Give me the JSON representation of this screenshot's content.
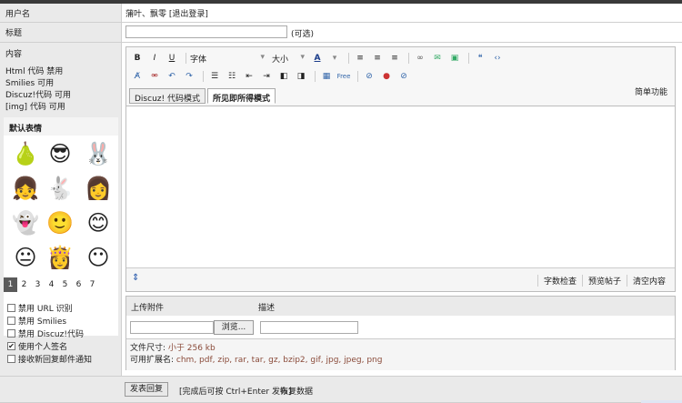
{
  "username": {
    "label": "用户名",
    "value": "蒲叶、飘零 [退出登录]"
  },
  "subject": {
    "label": "标题",
    "value": "",
    "optional": "(可选)"
  },
  "content": {
    "label": "内容",
    "status": [
      "Html 代码 禁用",
      "Smilies 可用",
      "Discuz!代码 可用",
      "[img] 代码 可用"
    ],
    "smilies_title": "默认表情",
    "smilies": [
      "pear-face-icon",
      "cool-sunglasses-face-icon",
      "pink-bunny-icon",
      "gray-hair-girl-icon",
      "bunny-girl-icon",
      "red-hair-girl-icon",
      "white-blob-icon",
      "white-hair-girl-icon",
      "white-hair-girl-2-icon",
      "white-hair-girl-3-icon",
      "dark-hair-girl-icon",
      "white-hair-girl-4-icon"
    ],
    "pages": [
      "1",
      "2",
      "3",
      "4",
      "5",
      "6",
      "7"
    ],
    "options": [
      {
        "label": "禁用 URL 识别",
        "checked": false
      },
      {
        "label": "禁用 Smilies",
        "checked": false
      },
      {
        "label": "禁用 Discuz!代码",
        "checked": false
      },
      {
        "label": "使用个人签名",
        "checked": true
      },
      {
        "label": "接收新回复邮件通知",
        "checked": false
      }
    ]
  },
  "editor": {
    "font_label": "字体",
    "size_label": "大小",
    "tabs": [
      "Discuz! 代码模式",
      "所见即所得模式"
    ],
    "simple_label": "简单功能",
    "footer": [
      "字数检查",
      "预览帖子",
      "清空内容"
    ]
  },
  "attachments": {
    "header_label": "上传附件",
    "desc_label": "描述",
    "browse_label": "浏览...",
    "size_text": "文件尺寸: ",
    "size_value": "小于 256 kb",
    "ext_text": "可用扩展名: ",
    "ext_value": "chm, pdf, zip, rar, tar, gz, bzip2, gif, jpg, jpeg, png"
  },
  "submit": {
    "label": "发表回复",
    "hint": "[完成后可按 Ctrl+Enter 发布]",
    "restore": "恢复数据"
  }
}
